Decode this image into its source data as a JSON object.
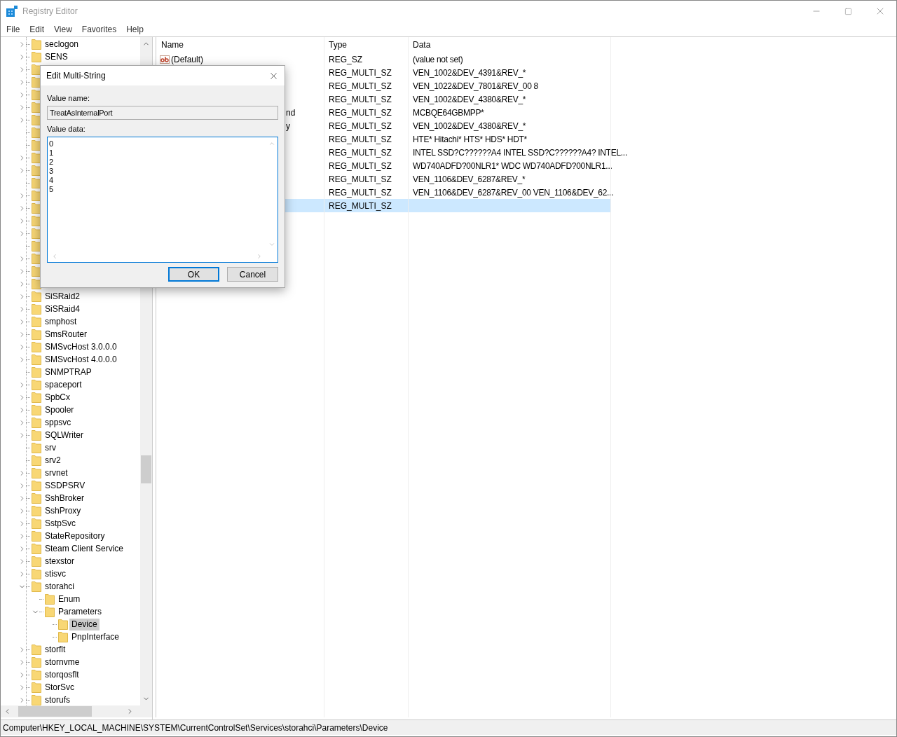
{
  "window": {
    "title": "Registry Editor"
  },
  "menu": [
    "File",
    "Edit",
    "View",
    "Favorites",
    "Help"
  ],
  "tree": [
    {
      "name": "seclogon",
      "expandable": true,
      "expanded": false,
      "selected": false
    },
    {
      "name": "SENS",
      "expandable": true,
      "expanded": false,
      "selected": false
    },
    {
      "expandable": true,
      "expanded": false
    },
    {
      "expandable": true,
      "expanded": false
    },
    {
      "expandable": true,
      "expanded": false
    },
    {
      "expandable": true,
      "expanded": false
    },
    {
      "expandable": true,
      "expanded": false
    },
    {
      "expandable": false
    },
    {
      "expandable": false
    },
    {
      "expandable": true,
      "expanded": false
    },
    {
      "expandable": true,
      "expanded": false
    },
    {
      "expandable": false
    },
    {
      "expandable": true,
      "expanded": false
    },
    {
      "expandable": true,
      "expanded": false
    },
    {
      "expandable": true,
      "expanded": false
    },
    {
      "expandable": true,
      "expanded": false
    },
    {
      "expandable": false
    },
    {
      "expandable": true,
      "expanded": false
    },
    {
      "expandable": true,
      "expanded": false
    },
    {
      "expandable": true,
      "expanded": false
    },
    {
      "name": "SiSRaid2",
      "expandable": true,
      "expanded": false,
      "selected": false
    },
    {
      "name": "SiSRaid4",
      "expandable": true,
      "expanded": false,
      "selected": false
    },
    {
      "name": "smphost",
      "expandable": true,
      "expanded": false,
      "selected": false
    },
    {
      "name": "SmsRouter",
      "expandable": true,
      "expanded": false,
      "selected": false
    },
    {
      "name": "SMSvcHost 3.0.0.0",
      "expandable": true,
      "expanded": false,
      "selected": false
    },
    {
      "name": "SMSvcHost 4.0.0.0",
      "expandable": true,
      "expanded": false,
      "selected": false
    },
    {
      "name": "SNMPTRAP",
      "expandable": false,
      "selected": false
    },
    {
      "name": "spaceport",
      "expandable": true,
      "expanded": false,
      "selected": false
    },
    {
      "name": "SpbCx",
      "expandable": true,
      "expanded": false,
      "selected": false
    },
    {
      "name": "Spooler",
      "expandable": true,
      "expanded": false,
      "selected": false
    },
    {
      "name": "sppsvc",
      "expandable": true,
      "expanded": false,
      "selected": false
    },
    {
      "name": "SQLWriter",
      "expandable": true,
      "expanded": false,
      "selected": false
    },
    {
      "name": "srv",
      "expandable": false,
      "selected": false
    },
    {
      "name": "srv2",
      "expandable": false,
      "selected": false
    },
    {
      "name": "srvnet",
      "expandable": true,
      "expanded": false,
      "selected": false
    },
    {
      "name": "SSDPSRV",
      "expandable": true,
      "expanded": false,
      "selected": false
    },
    {
      "name": "SshBroker",
      "expandable": true,
      "expanded": false,
      "selected": false
    },
    {
      "name": "SshProxy",
      "expandable": true,
      "expanded": false,
      "selected": false
    },
    {
      "name": "SstpSvc",
      "expandable": true,
      "expanded": false,
      "selected": false
    },
    {
      "name": "StateRepository",
      "expandable": true,
      "expanded": false,
      "selected": false
    },
    {
      "name": "Steam Client Service",
      "expandable": true,
      "expanded": false,
      "selected": false
    },
    {
      "name": "stexstor",
      "expandable": true,
      "expanded": false,
      "selected": false
    },
    {
      "name": "stisvc",
      "expandable": true,
      "expanded": false,
      "selected": false
    },
    {
      "name": "storahci",
      "expandable": true,
      "expanded": true,
      "selected": false,
      "children": [
        {
          "name": "Enum",
          "expandable": false,
          "selected": false
        },
        {
          "name": "Parameters",
          "expandable": true,
          "expanded": true,
          "selected": false,
          "children": [
            {
              "name": "Device",
              "expandable": false,
              "selected": true
            },
            {
              "name": "PnpInterface",
              "expandable": false,
              "selected": false
            }
          ]
        }
      ]
    },
    {
      "name": "storflt",
      "expandable": true,
      "expanded": false,
      "selected": false
    },
    {
      "name": "stornvme",
      "expandable": true,
      "expanded": false,
      "selected": false
    },
    {
      "name": "storqosflt",
      "expandable": true,
      "expanded": false,
      "selected": false
    },
    {
      "name": "StorSvc",
      "expandable": true,
      "expanded": false,
      "selected": false
    },
    {
      "name": "storufs",
      "expandable": true,
      "expanded": false,
      "selected": false
    }
  ],
  "values": {
    "columns": [
      "Name",
      "Type",
      "Data"
    ],
    "rows": [
      {
        "name": "(Default)",
        "type": "REG_SZ",
        "data": "(value not set)",
        "selected": false
      },
      {
        "type": "REG_MULTI_SZ",
        "data": "VEN_1002&DEV_4391&REV_*",
        "selected": false
      },
      {
        "type": "REG_MULTI_SZ",
        "data": "VEN_1022&DEV_7801&REV_00 8",
        "selected": false
      },
      {
        "type": "REG_MULTI_SZ",
        "data": "VEN_1002&DEV_4380&REV_*",
        "selected": false
      },
      {
        "name_tail": "nd",
        "type": "REG_MULTI_SZ",
        "data": "MCBQE64GBMPP*",
        "selected": false
      },
      {
        "name_tail": "y",
        "type": "REG_MULTI_SZ",
        "data": "VEN_1002&DEV_4380&REV_*",
        "selected": false
      },
      {
        "type": "REG_MULTI_SZ",
        "data": "HTE* Hitachi* HTS* HDS* HDT*",
        "selected": false
      },
      {
        "type": "REG_MULTI_SZ",
        "data": "INTEL SSD?C??????A4 INTEL SSD?C??????A4? INTEL...",
        "selected": false
      },
      {
        "type": "REG_MULTI_SZ",
        "data": "WD740ADFD?00NLR1* WDC WD740ADFD?00NLR1...",
        "selected": false
      },
      {
        "type": "REG_MULTI_SZ",
        "data": "VEN_1106&DEV_6287&REV_*",
        "selected": false
      },
      {
        "type": "REG_MULTI_SZ",
        "data": "VEN_1106&DEV_6287&REV_00 VEN_1106&DEV_62...",
        "selected": false
      },
      {
        "type": "REG_MULTI_SZ",
        "selected": true
      }
    ]
  },
  "dialog": {
    "title": "Edit Multi-String",
    "value_name_label": "Value name:",
    "value_name": "TreatAsInternalPort",
    "value_data_label": "Value data:",
    "value_data": "0\n1\n2\n3\n4\n5",
    "buttons": [
      {
        "label": "OK",
        "default": true
      },
      {
        "label": "Cancel",
        "default": false
      }
    ]
  },
  "status_bar": "Computer\\HKEY_LOCAL_MACHINE\\SYSTEM\\CurrentControlSet\\Services\\storahci\\Parameters\\Device"
}
